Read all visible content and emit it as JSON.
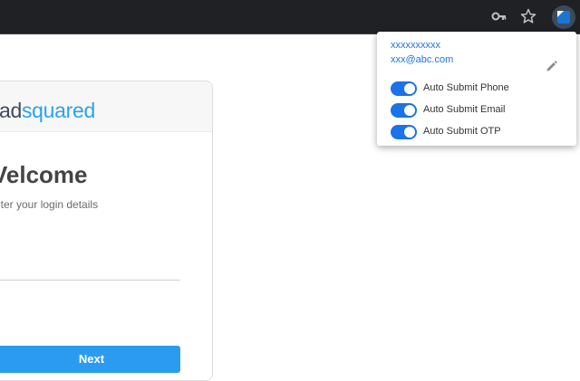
{
  "browser": {
    "icons": [
      "key-icon",
      "star-icon",
      "extension-icon"
    ]
  },
  "page": {
    "logo_part1": "ad",
    "logo_part2": "squared",
    "welcome_heading": "Velcome",
    "subtext": "nter your login details",
    "next_button_label": "Next"
  },
  "popup": {
    "account_name": "xxxxxxxxxx",
    "account_email": "xxx@abc.com",
    "edit_icon": "pencil-icon",
    "toggles": [
      {
        "label": "Auto Submit Phone",
        "on": true
      },
      {
        "label": "Auto Submit Email",
        "on": true
      },
      {
        "label": "Auto Submit OTP",
        "on": true
      }
    ]
  },
  "colors": {
    "toolbar": "#202124",
    "accent_blue": "#1a73e8",
    "next_button": "#2b9bf0",
    "logo_dark": "#3f4a5c",
    "logo_light": "#2aa3e8"
  }
}
